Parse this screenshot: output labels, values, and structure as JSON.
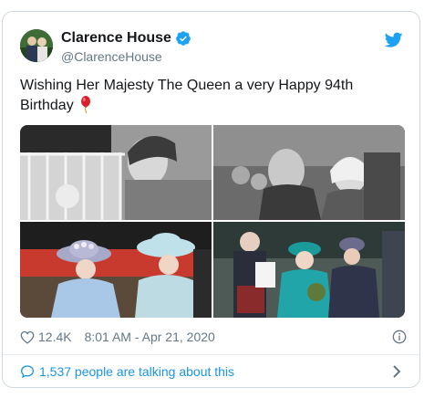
{
  "tweet": {
    "display_name": "Clarence House",
    "handle": "@ClarenceHouse",
    "text": "Wishing Her Majesty The Queen a very Happy 94th Birthday",
    "likes": "12.4K",
    "timestamp": "8:01 AM - Apr 21, 2020",
    "talking": "1,537 people are talking about this"
  },
  "icons": {
    "verified": "verified-badge-icon",
    "brand": "twitter-bird-icon",
    "emoji": "balloon-icon",
    "like": "heart-icon",
    "info": "info-icon",
    "reply": "speech-bubble-icon",
    "more": "chevron-right-icon"
  },
  "colors": {
    "brand": "#1da1f2",
    "link": "#1b95e0",
    "muted": "#657786",
    "text": "#14171a",
    "border": "#cfd9de"
  }
}
